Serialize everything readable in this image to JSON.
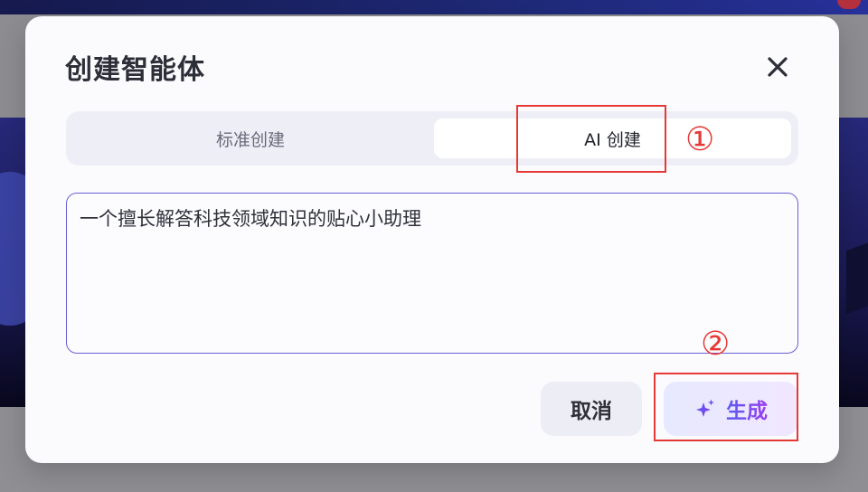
{
  "dialog": {
    "title": "创建智能体",
    "close_icon": "close-icon"
  },
  "tabs": [
    {
      "label": "标准创建",
      "selected": false
    },
    {
      "label": "AI 创建",
      "selected": true
    }
  ],
  "prompt": {
    "value": "一个擅长解答科技领域知识的贴心小助理"
  },
  "buttons": {
    "cancel": "取消",
    "generate": "生成",
    "generate_icon": "sparkle-icon"
  },
  "annotations": {
    "step1": "①",
    "step2": "②"
  },
  "colors": {
    "accent": "#6a4df0",
    "annotation": "#e53935"
  }
}
